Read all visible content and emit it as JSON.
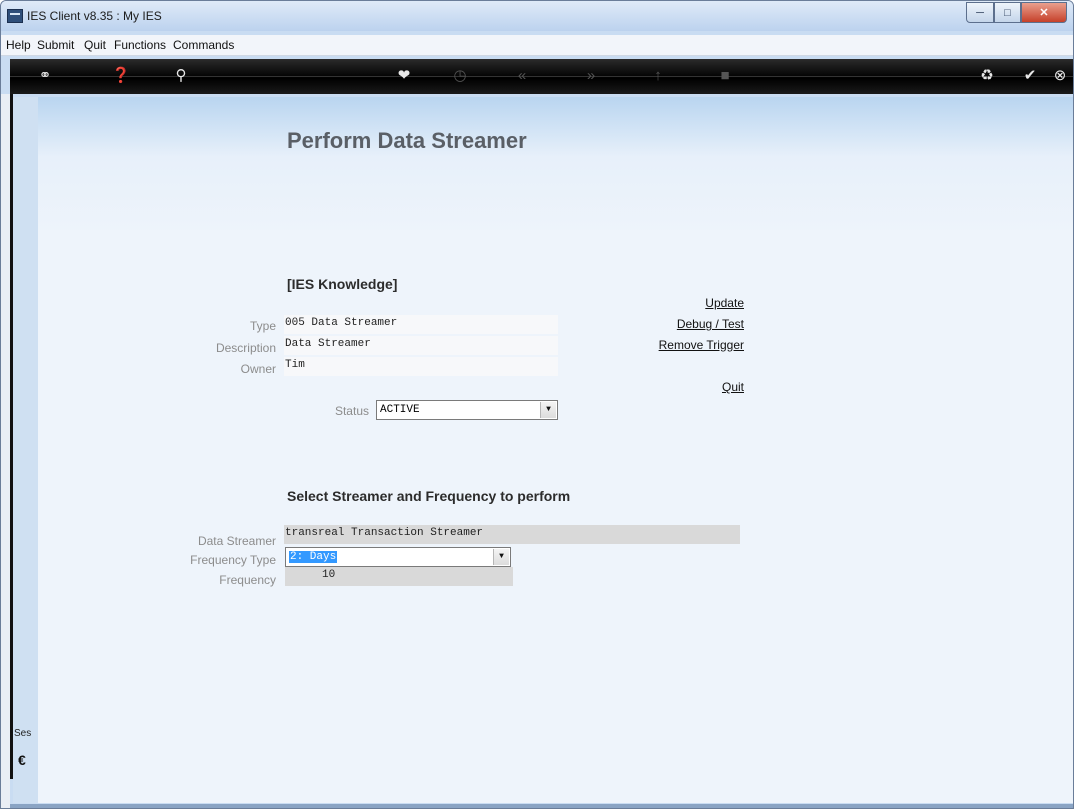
{
  "window": {
    "title": "IES Client v8.35 : My IES"
  },
  "menu": [
    "Help",
    "Submit",
    "Quit",
    "Functions",
    "Commands"
  ],
  "toolbar": {
    "icons": [
      "key-icon",
      "help-icon",
      "search-icon",
      "heart-icon",
      "clock-icon",
      "rewind-icon",
      "fast-forward-icon",
      "tools-icon",
      "stop-icon",
      "recycle-icon",
      "check-icon",
      "close-icon"
    ]
  },
  "page": {
    "title": "Perform Data Streamer"
  },
  "knowledge": {
    "heading": "[IES Knowledge]",
    "type_label": "Type",
    "type_value": "005 Data Streamer",
    "description_label": "Description",
    "description_value": "Data Streamer",
    "owner_label": "Owner",
    "owner_value": "Tim",
    "status_label": "Status",
    "status_value": "ACTIVE"
  },
  "actions": {
    "update": "Update",
    "debug": "Debug / Test",
    "remove": "Remove Trigger",
    "quit": "Quit"
  },
  "streamer": {
    "heading": "Select Streamer and Frequency to perform",
    "data_streamer_label": "Data Streamer",
    "data_streamer_value": "transreal Transaction Streamer",
    "frequency_type_label": "Frequency Type",
    "frequency_type_value": "2: Days",
    "frequency_label": "Frequency",
    "frequency_value": "10"
  },
  "session": {
    "label": "Ses"
  }
}
